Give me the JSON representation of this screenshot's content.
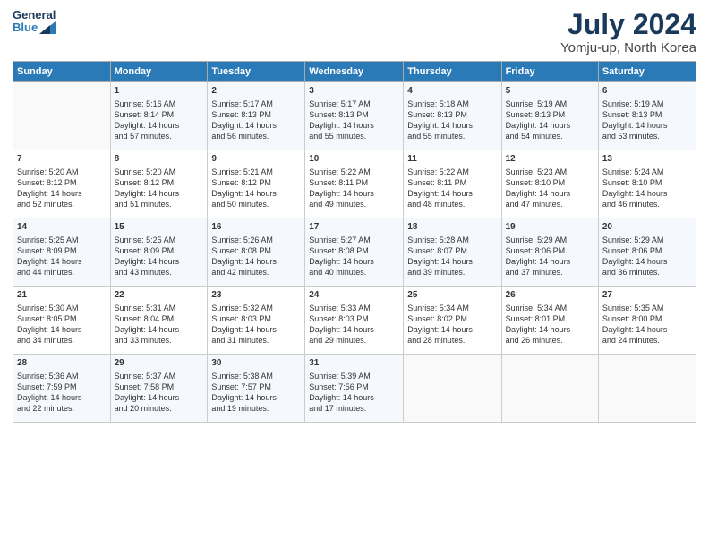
{
  "header": {
    "logo_line1": "General",
    "logo_line2": "Blue",
    "month": "July 2024",
    "location": "Yomju-up, North Korea"
  },
  "days_of_week": [
    "Sunday",
    "Monday",
    "Tuesday",
    "Wednesday",
    "Thursday",
    "Friday",
    "Saturday"
  ],
  "weeks": [
    [
      {
        "day": "",
        "info": ""
      },
      {
        "day": "1",
        "info": "Sunrise: 5:16 AM\nSunset: 8:14 PM\nDaylight: 14 hours\nand 57 minutes."
      },
      {
        "day": "2",
        "info": "Sunrise: 5:17 AM\nSunset: 8:13 PM\nDaylight: 14 hours\nand 56 minutes."
      },
      {
        "day": "3",
        "info": "Sunrise: 5:17 AM\nSunset: 8:13 PM\nDaylight: 14 hours\nand 55 minutes."
      },
      {
        "day": "4",
        "info": "Sunrise: 5:18 AM\nSunset: 8:13 PM\nDaylight: 14 hours\nand 55 minutes."
      },
      {
        "day": "5",
        "info": "Sunrise: 5:19 AM\nSunset: 8:13 PM\nDaylight: 14 hours\nand 54 minutes."
      },
      {
        "day": "6",
        "info": "Sunrise: 5:19 AM\nSunset: 8:13 PM\nDaylight: 14 hours\nand 53 minutes."
      }
    ],
    [
      {
        "day": "7",
        "info": "Sunrise: 5:20 AM\nSunset: 8:12 PM\nDaylight: 14 hours\nand 52 minutes."
      },
      {
        "day": "8",
        "info": "Sunrise: 5:20 AM\nSunset: 8:12 PM\nDaylight: 14 hours\nand 51 minutes."
      },
      {
        "day": "9",
        "info": "Sunrise: 5:21 AM\nSunset: 8:12 PM\nDaylight: 14 hours\nand 50 minutes."
      },
      {
        "day": "10",
        "info": "Sunrise: 5:22 AM\nSunset: 8:11 PM\nDaylight: 14 hours\nand 49 minutes."
      },
      {
        "day": "11",
        "info": "Sunrise: 5:22 AM\nSunset: 8:11 PM\nDaylight: 14 hours\nand 48 minutes."
      },
      {
        "day": "12",
        "info": "Sunrise: 5:23 AM\nSunset: 8:10 PM\nDaylight: 14 hours\nand 47 minutes."
      },
      {
        "day": "13",
        "info": "Sunrise: 5:24 AM\nSunset: 8:10 PM\nDaylight: 14 hours\nand 46 minutes."
      }
    ],
    [
      {
        "day": "14",
        "info": "Sunrise: 5:25 AM\nSunset: 8:09 PM\nDaylight: 14 hours\nand 44 minutes."
      },
      {
        "day": "15",
        "info": "Sunrise: 5:25 AM\nSunset: 8:09 PM\nDaylight: 14 hours\nand 43 minutes."
      },
      {
        "day": "16",
        "info": "Sunrise: 5:26 AM\nSunset: 8:08 PM\nDaylight: 14 hours\nand 42 minutes."
      },
      {
        "day": "17",
        "info": "Sunrise: 5:27 AM\nSunset: 8:08 PM\nDaylight: 14 hours\nand 40 minutes."
      },
      {
        "day": "18",
        "info": "Sunrise: 5:28 AM\nSunset: 8:07 PM\nDaylight: 14 hours\nand 39 minutes."
      },
      {
        "day": "19",
        "info": "Sunrise: 5:29 AM\nSunset: 8:06 PM\nDaylight: 14 hours\nand 37 minutes."
      },
      {
        "day": "20",
        "info": "Sunrise: 5:29 AM\nSunset: 8:06 PM\nDaylight: 14 hours\nand 36 minutes."
      }
    ],
    [
      {
        "day": "21",
        "info": "Sunrise: 5:30 AM\nSunset: 8:05 PM\nDaylight: 14 hours\nand 34 minutes."
      },
      {
        "day": "22",
        "info": "Sunrise: 5:31 AM\nSunset: 8:04 PM\nDaylight: 14 hours\nand 33 minutes."
      },
      {
        "day": "23",
        "info": "Sunrise: 5:32 AM\nSunset: 8:03 PM\nDaylight: 14 hours\nand 31 minutes."
      },
      {
        "day": "24",
        "info": "Sunrise: 5:33 AM\nSunset: 8:03 PM\nDaylight: 14 hours\nand 29 minutes."
      },
      {
        "day": "25",
        "info": "Sunrise: 5:34 AM\nSunset: 8:02 PM\nDaylight: 14 hours\nand 28 minutes."
      },
      {
        "day": "26",
        "info": "Sunrise: 5:34 AM\nSunset: 8:01 PM\nDaylight: 14 hours\nand 26 minutes."
      },
      {
        "day": "27",
        "info": "Sunrise: 5:35 AM\nSunset: 8:00 PM\nDaylight: 14 hours\nand 24 minutes."
      }
    ],
    [
      {
        "day": "28",
        "info": "Sunrise: 5:36 AM\nSunset: 7:59 PM\nDaylight: 14 hours\nand 22 minutes."
      },
      {
        "day": "29",
        "info": "Sunrise: 5:37 AM\nSunset: 7:58 PM\nDaylight: 14 hours\nand 20 minutes."
      },
      {
        "day": "30",
        "info": "Sunrise: 5:38 AM\nSunset: 7:57 PM\nDaylight: 14 hours\nand 19 minutes."
      },
      {
        "day": "31",
        "info": "Sunrise: 5:39 AM\nSunset: 7:56 PM\nDaylight: 14 hours\nand 17 minutes."
      },
      {
        "day": "",
        "info": ""
      },
      {
        "day": "",
        "info": ""
      },
      {
        "day": "",
        "info": ""
      }
    ]
  ]
}
